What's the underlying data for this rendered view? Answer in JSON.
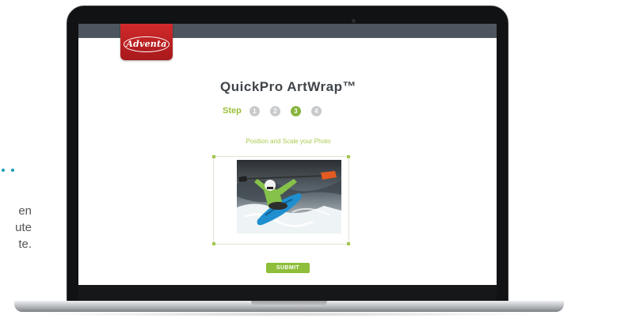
{
  "side_panel": {
    "line_1": "en",
    "line_2": "ute",
    "line_3": "te."
  },
  "logo": {
    "text": "Adventa"
  },
  "app": {
    "title": "QuickPro ArtWrap™",
    "step_label": "Step",
    "steps": [
      "1",
      "2",
      "3",
      "4"
    ],
    "active_step": 3,
    "instruction": "Position and Scale your Photo",
    "submit_label": "SUBMIT"
  },
  "photo": {
    "subject": "kayaker paddling through whitewater"
  },
  "colors": {
    "brand_red": "#c8262a",
    "accent_green": "#8ebe3a",
    "step_inactive": "#c9cacc",
    "topbar": "#4d565e"
  },
  "icons": [
    "camera-icon"
  ]
}
